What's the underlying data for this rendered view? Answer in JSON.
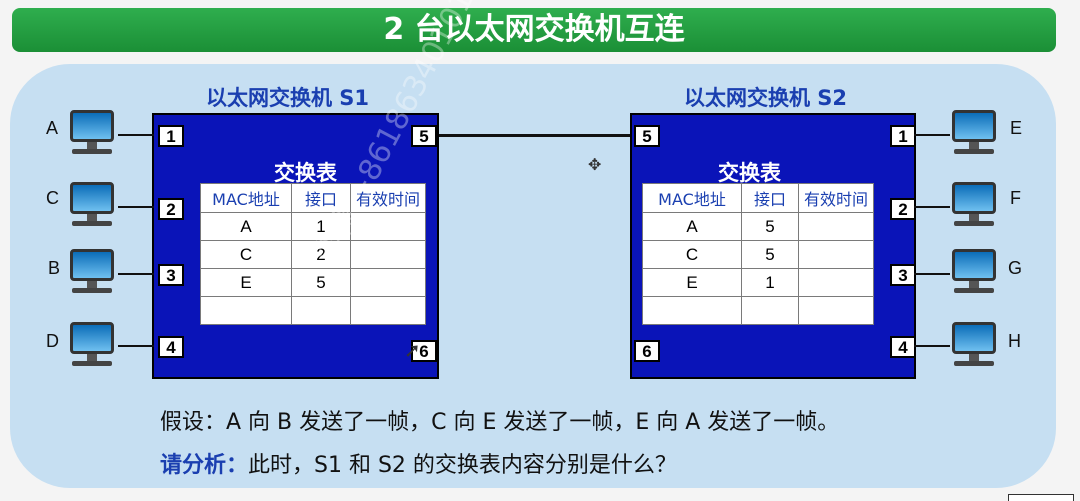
{
  "title": "2 台以太网交换机互连",
  "switches": [
    {
      "name": "以太网交换机 S1",
      "table_title": "交换表",
      "ports": [
        "1",
        "2",
        "3",
        "4",
        "5",
        "6"
      ],
      "headers": [
        "MAC地址",
        "接口",
        "有效时间"
      ],
      "rows": [
        [
          "A",
          "1",
          ""
        ],
        [
          "C",
          "2",
          ""
        ],
        [
          "E",
          "5",
          ""
        ],
        [
          "",
          "",
          ""
        ]
      ]
    },
    {
      "name": "以太网交换机 S2",
      "table_title": "交换表",
      "ports": [
        "5",
        "1",
        "2",
        "3",
        "4",
        "6"
      ],
      "headers": [
        "MAC地址",
        "接口",
        "有效时间"
      ],
      "rows": [
        [
          "A",
          "5",
          ""
        ],
        [
          "C",
          "5",
          ""
        ],
        [
          "E",
          "1",
          ""
        ],
        [
          "",
          "",
          ""
        ]
      ]
    }
  ],
  "hosts_left": [
    "A",
    "C",
    "B",
    "D"
  ],
  "hosts_right": [
    "E",
    "F",
    "G",
    "H"
  ],
  "question": {
    "assume": "假设：A 向 B 发送了一帧，C 向 E 发送了一帧，E 向 A 发送了一帧。",
    "ask_label": "请分析：",
    "ask_text": "此时，S1 和 S2 的交换表内容分别是什么？"
  },
  "watermark": "李赣 +8618634010107",
  "colors": {
    "switch": "#0a14b8",
    "title_bar": "#1b8f36",
    "accent": "#1a3fb0",
    "panel": "#c6dff2"
  }
}
